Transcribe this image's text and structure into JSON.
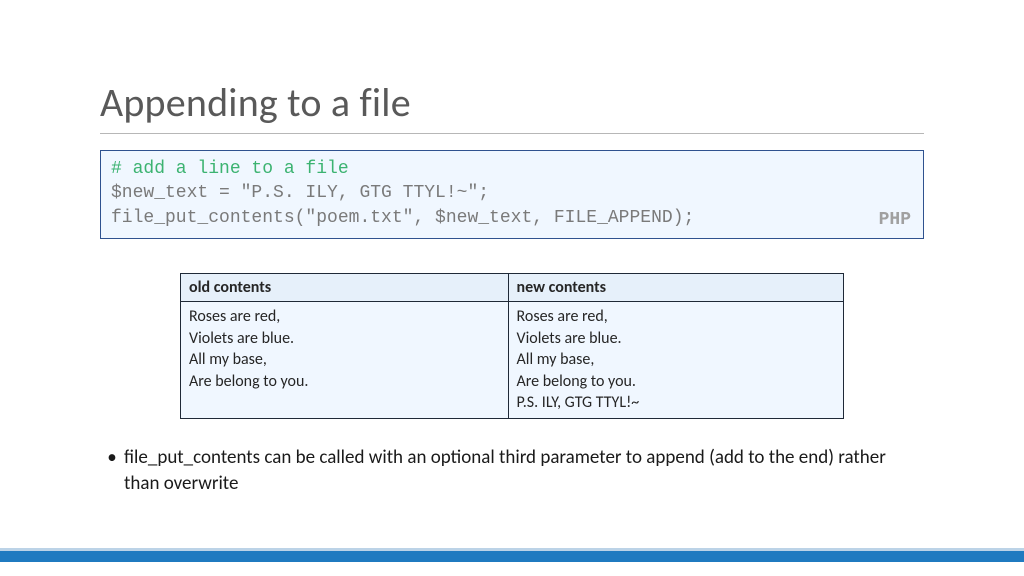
{
  "title": "Appending to a file",
  "code": {
    "comment": "# add a line to a file",
    "line2": "$new_text = \"P.S. ILY, GTG TTYL!~\";",
    "line3": "file_put_contents(\"poem.txt\", $new_text, FILE_APPEND);",
    "lang": "PHP"
  },
  "table": {
    "header_old": "old contents",
    "header_new": "new contents",
    "old_contents": "Roses are red,\nViolets are blue.\nAll my base,\nAre belong to you.",
    "new_contents": "Roses are red,\nViolets are blue.\nAll my base,\nAre belong to you.\nP.S. ILY, GTG TTYL!~"
  },
  "bullet1": "file_put_contents can be called with an optional third parameter to append (add to the end) rather than overwrite"
}
